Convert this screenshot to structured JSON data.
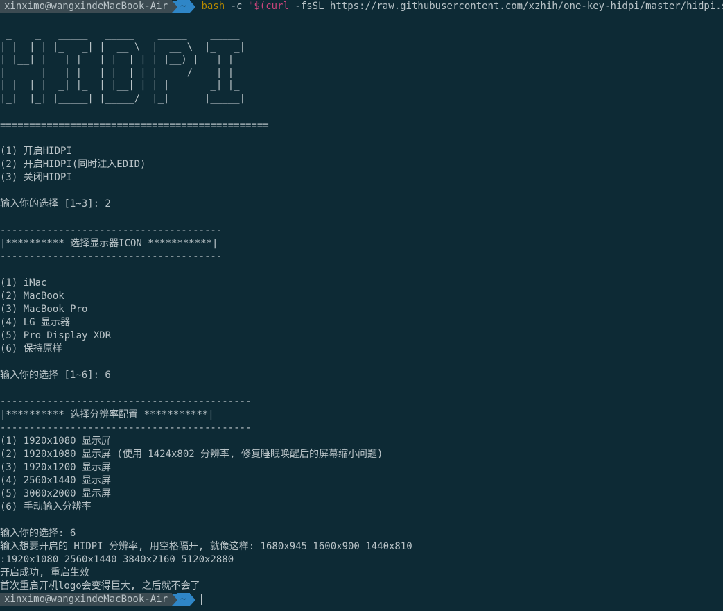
{
  "prompt": {
    "user_host": "xinximo@wangxindeMacBook-Air",
    "dir": "~"
  },
  "command": {
    "bin": "bash",
    "flag": "-c",
    "quote_open": "\"$(curl",
    "curl_flags": "-fsSL",
    "url": "https://raw.githubusercontent.com/xzhih/one-key-hidpi/master/hidpi.sh",
    "quote_close": ")\""
  },
  "ascii_logo": " _    _   _____   _____    _____    _____ \n| |  | | |_   _| |  __ \\  |  __ \\  |_   _|\n| |__| |   | |   | |  | | | |__) |   | |  \n|  __  |   | |   | |  | | |  ___/    | |  \n| |  | |  _| |_  | |__| | | |       _| |_ \n|_|  |_| |_____| |_____/  |_|      |_____|",
  "divider_main": "==============================================",
  "menu_main": [
    "(1) 开启HIDPI",
    "(2) 开启HIDPI(同时注入EDID)",
    "(3) 关闭HIDPI"
  ],
  "choice_main": "输入你的选择 [1~3]: 2",
  "icon_section": {
    "divider": "--------------------------------------",
    "header": "|********** 选择显示器ICON ***********|"
  },
  "menu_icon": [
    "(1) iMac",
    "(2) MacBook",
    "(3) MacBook Pro",
    "(4) LG 显示器",
    "(5) Pro Display XDR",
    "(6) 保持原样"
  ],
  "choice_icon": "输入你的选择 [1~6]: 6",
  "res_section": {
    "divider": "-------------------------------------------",
    "header": "|********** 选择分辨率配置 ***********|"
  },
  "menu_res": [
    "(1) 1920x1080 显示屏",
    "(2) 1920x1080 显示屏 (使用 1424x802 分辨率, 修复睡眠唤醒后的屏幕缩小问题)",
    "(3) 1920x1200 显示屏",
    "(4) 2560x1440 显示屏",
    "(5) 3000x2000 显示屏",
    "(6) 手动输入分辨率"
  ],
  "choice_res": "输入你的选择: 6",
  "input_prompt": "输入想要开启的 HIDPI 分辨率, 用空格隔开, 就像这样: 1680x945 1600x900 1440x810",
  "input_value": ":1920x1080 2560x1440 3840x2160 5120x2880",
  "success_msg": "开启成功, 重启生效",
  "note_msg": "首次重启开机logo会变得巨大, 之后就不会了"
}
